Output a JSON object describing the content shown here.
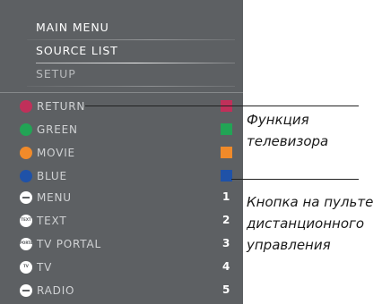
{
  "menu": {
    "main_menu": "MAIN MENU",
    "source_list": "SOURCE LIST",
    "setup": "SETUP"
  },
  "color_rows": [
    {
      "label": "RETURN",
      "color": "#c0305a"
    },
    {
      "label": "GREEN",
      "color": "#22a455"
    },
    {
      "label": "MOVIE",
      "color": "#f08a2a"
    },
    {
      "label": "BLUE",
      "color": "#1f52a8"
    }
  ],
  "button_rows": [
    {
      "label": "MENU",
      "number": "1",
      "icon": "minus-button-icon"
    },
    {
      "label": "TEXT",
      "number": "2",
      "icon": "text-button-icon",
      "icon_text": "TEXT"
    },
    {
      "label": "TV PORTAL",
      "number": "3",
      "icon": "portal-button-icon",
      "icon_text": "PORTAL"
    },
    {
      "label": "TV",
      "number": "4",
      "icon": "tv-button-icon",
      "icon_text": "TV"
    },
    {
      "label": "RADIO",
      "number": "5",
      "icon": "radio-button-icon"
    }
  ],
  "captions": {
    "tv_function": [
      "Функция",
      "телевизора"
    ],
    "remote_button": [
      "Кнопка на пульте",
      "дистанционного",
      "управления"
    ]
  }
}
